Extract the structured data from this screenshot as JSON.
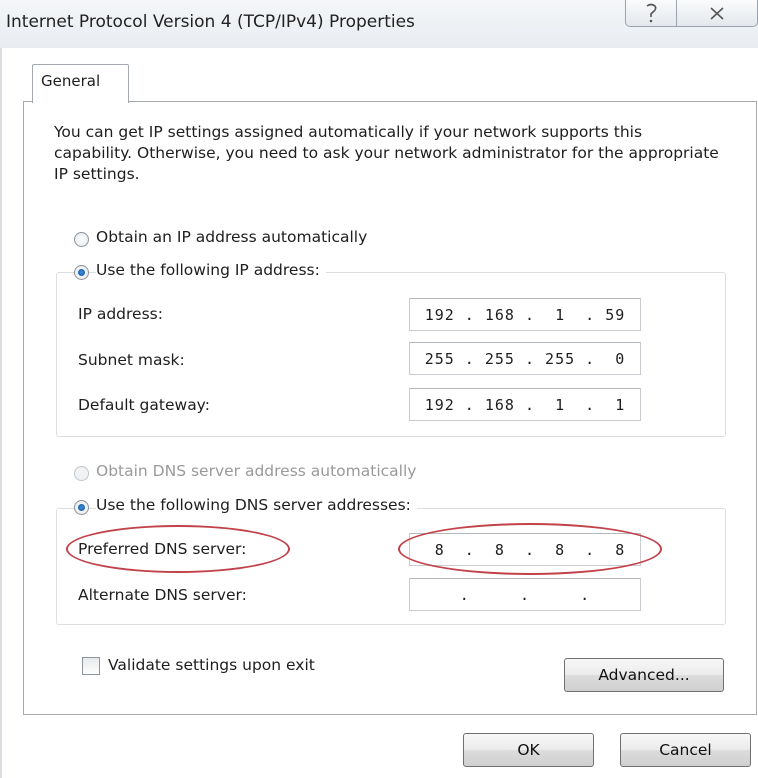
{
  "window": {
    "title": "Internet Protocol Version 4 (TCP/IPv4) Properties",
    "help_icon": "help-icon",
    "close_icon": "close-icon"
  },
  "tabs": [
    {
      "label": "General",
      "selected": true
    }
  ],
  "intro_text": "You can get IP settings assigned automatically if your network supports this capability. Otherwise, you need to ask your network administrator for the appropriate IP settings.",
  "ip_mode": {
    "auto_label": "Obtain an IP address automatically",
    "manual_label": "Use the following IP address:",
    "selected": "manual"
  },
  "ip_fields": {
    "ip_address": {
      "label": "IP address:",
      "value": "192 . 168 .  1  . 59"
    },
    "subnet_mask": {
      "label": "Subnet mask:",
      "value": "255 . 255 . 255 .  0"
    },
    "default_gateway": {
      "label": "Default gateway:",
      "value": "192 . 168 .  1  .  1"
    }
  },
  "dns_mode": {
    "auto_label": "Obtain DNS server address automatically",
    "auto_disabled": true,
    "manual_label": "Use the following DNS server addresses:",
    "selected": "manual"
  },
  "dns_fields": {
    "preferred": {
      "label": "Preferred DNS server:",
      "value": " 8  .  8  .  8  .  8"
    },
    "alternate": {
      "label": "Alternate DNS server:",
      "value": "   .     .     .   "
    }
  },
  "validate": {
    "label": "Validate settings upon exit",
    "checked": false
  },
  "buttons": {
    "advanced": "Advanced...",
    "ok": "OK",
    "cancel": "Cancel"
  },
  "annotation_color": "#c2424a"
}
